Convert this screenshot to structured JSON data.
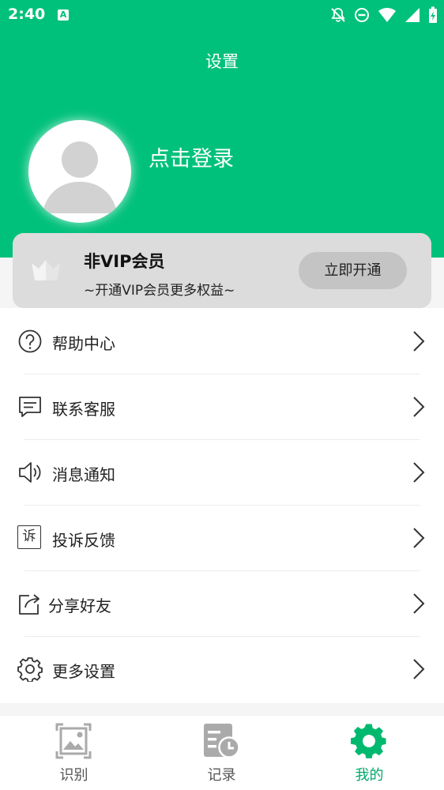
{
  "status_bar": {
    "time": "2:40",
    "app_icon_letter": "A",
    "icons": [
      "bell-off-icon",
      "do-not-disturb-icon",
      "wifi-icon",
      "cell-signal-icon",
      "battery-charging-icon"
    ]
  },
  "header": {
    "title": "设置",
    "login_text": "点击登录",
    "background_color": "#00c17c"
  },
  "vip": {
    "title": "非VIP会员",
    "subtitle": "~开通VIP会员更多权益~",
    "button_label": "立即开通",
    "icon": "crown-icon"
  },
  "menu": {
    "items": [
      {
        "label": "帮助中心",
        "icon": "help-circle-icon"
      },
      {
        "label": "联系客服",
        "icon": "chat-icon"
      },
      {
        "label": "消息通知",
        "icon": "speaker-icon"
      },
      {
        "label": "投诉反馈",
        "icon": "complaint-icon",
        "icon_text": "诉"
      },
      {
        "label": "分享好友",
        "icon": "share-icon"
      },
      {
        "label": "更多设置",
        "icon": "gear-icon"
      }
    ]
  },
  "bottom_nav": {
    "tabs": [
      {
        "label": "识别",
        "icon": "image-scan-icon"
      },
      {
        "label": "记录",
        "icon": "history-icon"
      },
      {
        "label": "我的",
        "icon": "settings-gear-icon",
        "active": true
      }
    ],
    "active_color": "#00a86b"
  }
}
